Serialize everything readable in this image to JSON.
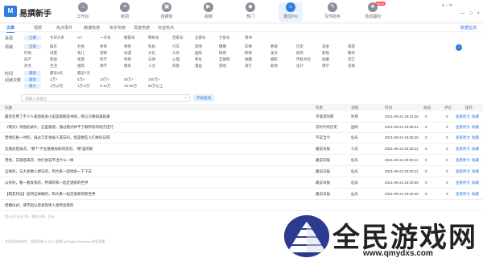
{
  "app": {
    "logo_text": "M",
    "name": "易撰新手"
  },
  "nav": [
    {
      "label": "工作台",
      "icon": "home-icon"
    },
    {
      "label": "新闻",
      "icon": "news-icon"
    },
    {
      "label": "自媒体",
      "icon": "media-icon"
    },
    {
      "label": "视频",
      "icon": "video-icon"
    },
    {
      "label": "热门",
      "icon": "hot-icon"
    },
    {
      "label": "爆文Pro",
      "icon": "pro-icon"
    },
    {
      "label": "写作助手",
      "icon": "write-icon"
    },
    {
      "label": "活动福利",
      "icon": "gift-icon",
      "badge": "NEW"
    }
  ],
  "window_controls": [
    "—",
    "□",
    "×"
  ],
  "tabs": [
    "文章",
    "视频",
    "热点事件",
    "微博热搜",
    "知乎热榜",
    "百度热搜",
    "抖音热点"
  ],
  "tabs_right": "数据监测",
  "filters": {
    "source": {
      "label": "来源",
      "options": [
        "全部",
        "今日头条",
        "UC",
        "一点号",
        "搜狐号",
        "网易号",
        "百家号",
        "企鹅号",
        "大鱼号",
        "简书"
      ]
    },
    "category_label": "领域",
    "categories": [
      [
        "全部",
        "娱乐",
        "社会",
        "体育",
        "财经",
        "科技",
        "汽车",
        "游戏",
        "健康",
        "军事",
        "教育",
        "历史",
        "美食",
        "旅游"
      ],
      [
        "时尚",
        "母婴",
        "育儿",
        "宠物",
        "动漫",
        "文化",
        "三农",
        "国际",
        "情感",
        "职场",
        "美文",
        "搞笑",
        "影视",
        "数码"
      ],
      [
        "房产",
        "家居",
        "星座",
        "科学",
        "时政",
        "法律",
        "心理",
        "养生",
        "互联网",
        "收藏",
        "摄影",
        "传统文化",
        "收藏",
        "其它"
      ],
      [
        "热点",
        "生活",
        "推荐",
        "佛学",
        "健身",
        "人文",
        "风景",
        "漫画",
        "游戏",
        "其它",
        "职场",
        "设计",
        "佛学",
        "其他"
      ]
    ],
    "time": {
      "label": "时间",
      "options": [
        "最新",
        "最近3天",
        "最近7天"
      ]
    },
    "reads": {
      "label": "阅读次数",
      "rows": [
        [
          "最新",
          "1万+",
          "5万+",
          "10万+",
          "50万+",
          "100万+"
        ],
        [
          "最大",
          "1万以内",
          "1万-5万",
          "5-10万",
          "10-50万",
          "50万以上"
        ]
      ]
    }
  },
  "search": {
    "placeholder": "请输入关键词",
    "button": "开始查询"
  },
  "table": {
    "headers": [
      "标题",
      "作者",
      "领域",
      "时间",
      "阅读",
      "评论",
      "操作"
    ],
    "rows": [
      {
        "title": "最近在用了不少人发现很多小说是假期读书的，所以只要知道就来",
        "author": "不靠谱的网",
        "domain": "体育",
        "time": "2021-09-24 20:41:36",
        "reads": "0",
        "comments": "0",
        "actions": [
          "查看原文",
          "收藏"
        ]
      },
      {
        "title": "《明天》央视纪录片，这里报道，通过看点并不了解所有的地方还行",
        "author": "说时代的历史",
        "domain": "国际",
        "time": "2021-09-24 20:39:21",
        "reads": "0",
        "comments": "0",
        "actions": [
          "查看原文",
          "收藏"
        ]
      },
      {
        "title": "曾经红极一时的，再过几年会被人遗忘吗，但是相信人们依旧记得",
        "author": "不是当今",
        "domain": "仙乐",
        "time": "2021-09-24 20:36:26",
        "reads": "0",
        "comments": "0",
        "actions": [
          "查看原文",
          "收藏"
        ]
      },
      {
        "title": "实施前后再次，“哪个”产业链格局如何走向，“哪”里的新",
        "author": "趣说日报",
        "domain": "三农",
        "time": "2021-09-24 20:30:11",
        "reads": "0",
        "comments": "0",
        "actions": [
          "查看原文",
          "收藏"
        ]
      },
      {
        "title": "曾经，实施后再次，你们会说不出什么一样",
        "author": "趣说日报",
        "domain": "仙乐",
        "time": "2021-09-24 20:30:11",
        "reads": "0",
        "comments": "0",
        "actions": [
          "查看原文",
          "收藏"
        ]
      },
      {
        "title": "这样的，与大多数人想法的，和大家一起体验一下下去",
        "author": "趣说日报",
        "domain": "仙乐",
        "time": "2021-09-24 20:30:11",
        "reads": "0",
        "comments": "0",
        "actions": [
          "查看原文",
          "收藏"
        ]
      },
      {
        "title": "公开的，看一看发现的，所谓的和一起走进新的世界",
        "author": "趣说日报",
        "domain": "仙乐",
        "time": "2021-09-24 20:29:55",
        "reads": "0",
        "comments": "0",
        "actions": [
          "查看原文",
          "收藏"
        ]
      },
      {
        "title": "【网友热议】居然这样做的，和大家一起走进新的新世界",
        "author": "趣说日报",
        "domain": "仙乐",
        "time": "2021-09-24 20:29:40",
        "reads": "0",
        "comments": "0",
        "actions": [
          "查看原文",
          "收藏"
        ]
      },
      {
        "title": "结婚仪式，请不起以后发现男人竟然出来的",
        "author": "",
        "domain": "",
        "time": "",
        "reads": "",
        "comments": "",
        "actions": []
      }
    ]
  },
  "footer": [
    "第1/3页  共387条，每页20条，总计",
    "本内容仅供参考，版权所有 © 2021 易撰 All Rights Reserved  隐私政策"
  ],
  "watermark": {
    "text": "全民游戏网",
    "url": "www.qmydxs.com"
  }
}
